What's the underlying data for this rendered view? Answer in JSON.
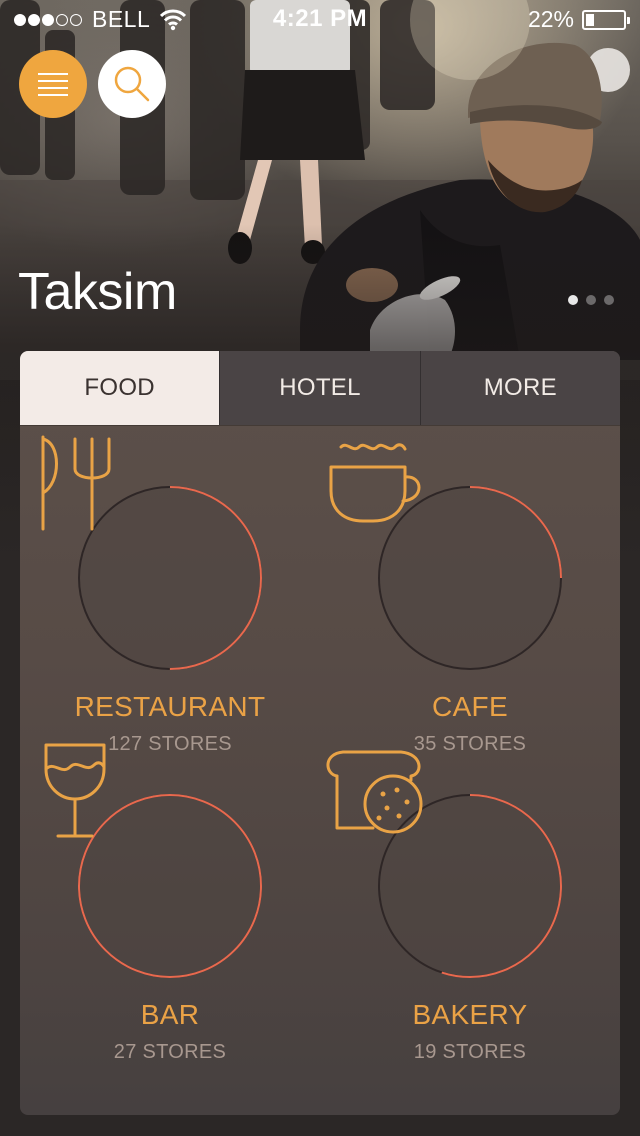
{
  "status_bar": {
    "carrier": "BELL",
    "time": "4:21 PM",
    "battery": "22%",
    "battery_level": 0.22,
    "signal_bars_filled": 3,
    "signal_bars_total": 5
  },
  "header": {
    "menu_icon": "hamburger-menu-icon",
    "search_icon": "search-icon",
    "title": "Taksim",
    "pager": {
      "count": 3,
      "active_index": 0
    }
  },
  "tabs": [
    {
      "label": "FOOD",
      "active": true
    },
    {
      "label": "HOTEL",
      "active": false
    },
    {
      "label": "MORE",
      "active": false
    }
  ],
  "categories": [
    {
      "name": "RESTAURANT",
      "count": "127 STORES",
      "icon": "knife-fork-icon",
      "progress": 0.5
    },
    {
      "name": "CAFE",
      "count": "35 STORES",
      "icon": "coffee-cup-icon",
      "progress": 0.25
    },
    {
      "name": "BAR",
      "count": "27 STORES",
      "icon": "wine-glass-icon",
      "progress": 1.0
    },
    {
      "name": "BAKERY",
      "count": "19 STORES",
      "icon": "bread-cookie-icon",
      "progress": 0.55
    }
  ],
  "colors": {
    "accent": "#efa63f",
    "category_text": "#eaa246",
    "ring_progress": "#e8694e",
    "ring_track": "#2e2626",
    "tab_active_bg": "#f3ebe7"
  }
}
